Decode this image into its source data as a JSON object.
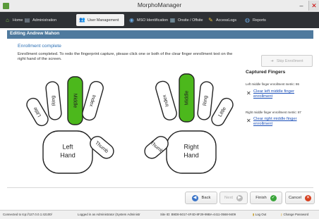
{
  "window": {
    "title": "MorphoManager",
    "minimize": "–",
    "close": "✕"
  },
  "tabs": [
    {
      "label": "Home",
      "icon": "home-icon",
      "glyph": "⌂"
    },
    {
      "label": "Administration",
      "icon": "administration-icon",
      "glyph": "▤"
    },
    {
      "label": "User Management",
      "icon": "user-management-icon",
      "glyph": "👥"
    },
    {
      "label": "MSO Identification",
      "icon": "mso-identification-icon",
      "glyph": "◉"
    },
    {
      "label": "Onsite / Offsite",
      "icon": "onsite-offsite-icon",
      "glyph": "▦"
    },
    {
      "label": "AccessLogs",
      "icon": "access-logs-icon",
      "glyph": "✎"
    },
    {
      "label": "Reports",
      "icon": "reports-icon",
      "glyph": "◍"
    }
  ],
  "panel": {
    "title": "Editing Andrew Mahon"
  },
  "enrollment": {
    "status": "Enrollment complete",
    "instructions": "Enrollment completed. To redo the fingerprint capture, please click one or both of the clear finger enrollment text on the right hand of the screen.",
    "skip_button": "Skip Enrollment"
  },
  "hands": {
    "left": {
      "label": [
        "Left",
        "Hand"
      ],
      "fingers": {
        "little": "Little",
        "ring": "Ring",
        "middle": "Middle",
        "index": "Index",
        "thumb": "Thumb"
      }
    },
    "right": {
      "label": [
        "Right",
        "Hand"
      ],
      "fingers": {
        "index": "Index",
        "middle": "Middle",
        "ring": "Ring",
        "little": "Little",
        "thumb": "Thumb"
      }
    },
    "captured_color": "#4cb81c"
  },
  "captured": {
    "title": "Captured Fingers",
    "items": [
      {
        "metric": "Left middle finger enrollment metric: 86",
        "link": "Clear left middle finger enrollment"
      },
      {
        "metric": "Right middle finger enrollment metric: 87",
        "link": "Clear right middle finger enrollment"
      }
    ]
  },
  "buttons": {
    "back": "Back",
    "next": "Next",
    "finish": "Finish",
    "cancel": "Cancel"
  },
  "statusbar": {
    "connection": "Connected to tcp://127.0.0.1:42100/",
    "login": "Logged in as Administrator (System Administr",
    "site": "Site ID: B9D8-5017-4F4D-8F29-99BA-4411-0568-9409",
    "logout": "Log Out",
    "change_password": "Change Password"
  }
}
